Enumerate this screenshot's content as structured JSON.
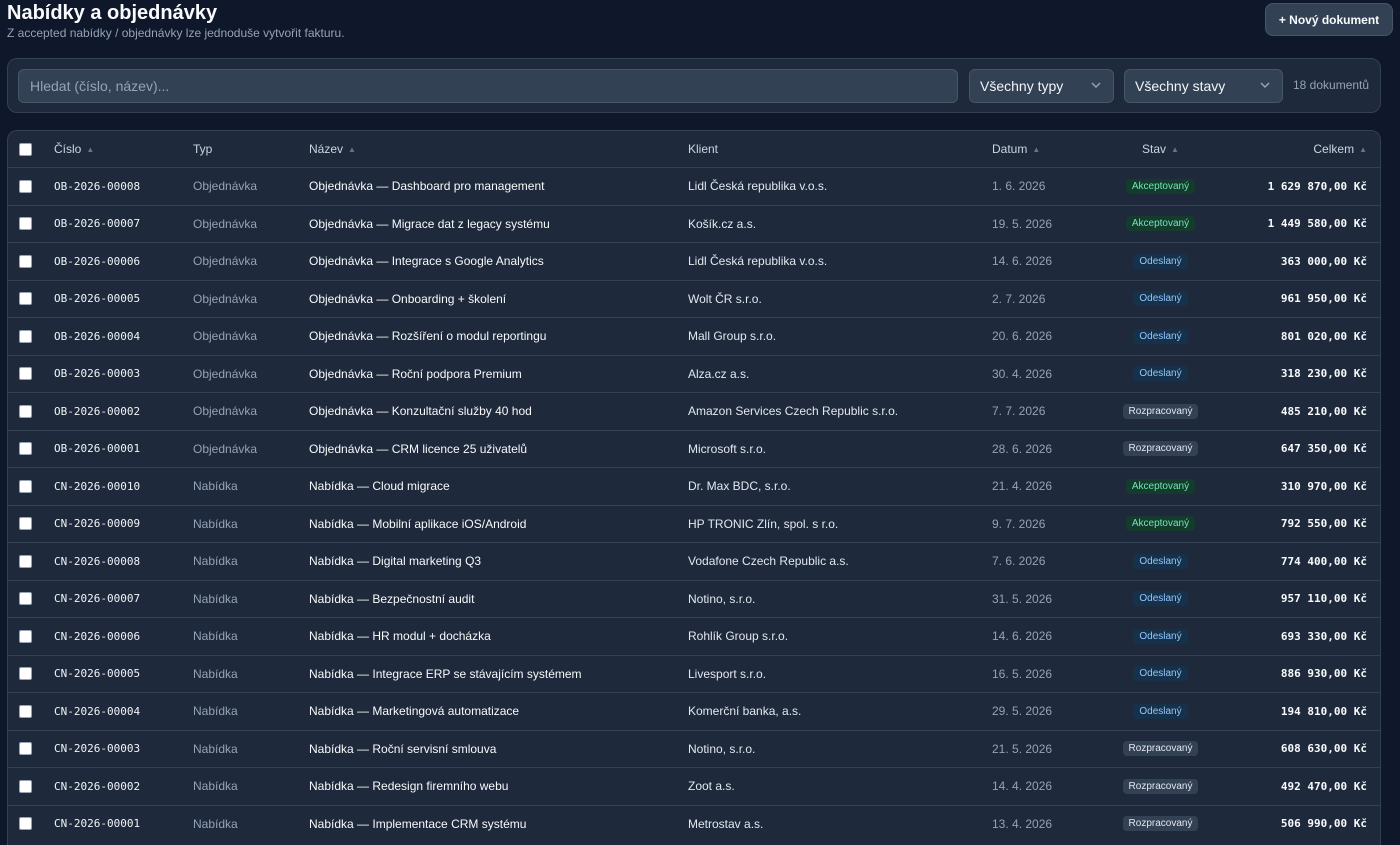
{
  "header": {
    "title": "Nabídky a objednávky",
    "subtitle": "Z accepted nabídky / objednávky lze jednoduše vytvořit fakturu.",
    "new_button": "+ Nový dokument"
  },
  "filters": {
    "search_placeholder": "Hledat (číslo, název)...",
    "type_select": "Všechny typy",
    "state_select": "Všechny stavy",
    "count": "18 dokumentů"
  },
  "table": {
    "columns": {
      "number": "Číslo",
      "type": "Typ",
      "name": "Název",
      "client": "Klient",
      "date": "Datum",
      "state": "Stav",
      "total": "Celkem"
    },
    "rows": [
      {
        "number": "OB-2026-00008",
        "type": "Objednávka",
        "name": "Objednávka — Dashboard pro management",
        "client": "Lidl Česká republika v.o.s.",
        "date": "1. 6. 2026",
        "state": "Akceptovaný",
        "state_kind": "accepted",
        "total": "1 629 870,00 Kč"
      },
      {
        "number": "OB-2026-00007",
        "type": "Objednávka",
        "name": "Objednávka — Migrace dat z legacy systému",
        "client": "Košík.cz a.s.",
        "date": "19. 5. 2026",
        "state": "Akceptovaný",
        "state_kind": "accepted",
        "total": "1 449 580,00 Kč"
      },
      {
        "number": "OB-2026-00006",
        "type": "Objednávka",
        "name": "Objednávka — Integrace s Google Analytics",
        "client": "Lidl Česká republika v.o.s.",
        "date": "14. 6. 2026",
        "state": "Odeslaný",
        "state_kind": "sent",
        "total": "363 000,00 Kč"
      },
      {
        "number": "OB-2026-00005",
        "type": "Objednávka",
        "name": "Objednávka — Onboarding + školení",
        "client": "Wolt ČR s.r.o.",
        "date": "2. 7. 2026",
        "state": "Odeslaný",
        "state_kind": "sent",
        "total": "961 950,00 Kč"
      },
      {
        "number": "OB-2026-00004",
        "type": "Objednávka",
        "name": "Objednávka — Rozšíření o modul reportingu",
        "client": "Mall Group s.r.o.",
        "date": "20. 6. 2026",
        "state": "Odeslaný",
        "state_kind": "sent",
        "total": "801 020,00 Kč"
      },
      {
        "number": "OB-2026-00003",
        "type": "Objednávka",
        "name": "Objednávka — Roční podpora Premium",
        "client": "Alza.cz a.s.",
        "date": "30. 4. 2026",
        "state": "Odeslaný",
        "state_kind": "sent",
        "total": "318 230,00 Kč"
      },
      {
        "number": "OB-2026-00002",
        "type": "Objednávka",
        "name": "Objednávka — Konzultační služby 40 hod",
        "client": "Amazon Services Czech Republic s.r.o.",
        "date": "7. 7. 2026",
        "state": "Rozpracovaný",
        "state_kind": "draft",
        "total": "485 210,00 Kč"
      },
      {
        "number": "OB-2026-00001",
        "type": "Objednávka",
        "name": "Objednávka — CRM licence 25 uživatelů",
        "client": "Microsoft s.r.o.",
        "date": "28. 6. 2026",
        "state": "Rozpracovaný",
        "state_kind": "draft",
        "total": "647 350,00 Kč"
      },
      {
        "number": "CN-2026-00010",
        "type": "Nabídka",
        "name": "Nabídka — Cloud migrace",
        "client": "Dr. Max BDC, s.r.o.",
        "date": "21. 4. 2026",
        "state": "Akceptovaný",
        "state_kind": "accepted",
        "total": "310 970,00 Kč"
      },
      {
        "number": "CN-2026-00009",
        "type": "Nabídka",
        "name": "Nabídka — Mobilní aplikace iOS/Android",
        "client": "HP TRONIC Zlín, spol. s r.o.",
        "date": "9. 7. 2026",
        "state": "Akceptovaný",
        "state_kind": "accepted",
        "total": "792 550,00 Kč"
      },
      {
        "number": "CN-2026-00008",
        "type": "Nabídka",
        "name": "Nabídka — Digital marketing Q3",
        "client": "Vodafone Czech Republic a.s.",
        "date": "7. 6. 2026",
        "state": "Odeslaný",
        "state_kind": "sent",
        "total": "774 400,00 Kč"
      },
      {
        "number": "CN-2026-00007",
        "type": "Nabídka",
        "name": "Nabídka — Bezpečnostní audit",
        "client": "Notino, s.r.o.",
        "date": "31. 5. 2026",
        "state": "Odeslaný",
        "state_kind": "sent",
        "total": "957 110,00 Kč"
      },
      {
        "number": "CN-2026-00006",
        "type": "Nabídka",
        "name": "Nabídka — HR modul + docházka",
        "client": "Rohlík Group s.r.o.",
        "date": "14. 6. 2026",
        "state": "Odeslaný",
        "state_kind": "sent",
        "total": "693 330,00 Kč"
      },
      {
        "number": "CN-2026-00005",
        "type": "Nabídka",
        "name": "Nabídka — Integrace ERP se stávajícím systémem",
        "client": "Livesport s.r.o.",
        "date": "16. 5. 2026",
        "state": "Odeslaný",
        "state_kind": "sent",
        "total": "886 930,00 Kč"
      },
      {
        "number": "CN-2026-00004",
        "type": "Nabídka",
        "name": "Nabídka — Marketingová automatizace",
        "client": "Komerční banka, a.s.",
        "date": "29. 5. 2026",
        "state": "Odeslaný",
        "state_kind": "sent",
        "total": "194 810,00 Kč"
      },
      {
        "number": "CN-2026-00003",
        "type": "Nabídka",
        "name": "Nabídka — Roční servisní smlouva",
        "client": "Notino, s.r.o.",
        "date": "21. 5. 2026",
        "state": "Rozpracovaný",
        "state_kind": "draft",
        "total": "608 630,00 Kč"
      },
      {
        "number": "CN-2026-00002",
        "type": "Nabídka",
        "name": "Nabídka — Redesign firemního webu",
        "client": "Zoot a.s.",
        "date": "14. 4. 2026",
        "state": "Rozpracovaný",
        "state_kind": "draft",
        "total": "492 470,00 Kč"
      },
      {
        "number": "CN-2026-00001",
        "type": "Nabídka",
        "name": "Nabídka — Implementace CRM systému",
        "client": "Metrostav a.s.",
        "date": "13. 4. 2026",
        "state": "Rozpracovaný",
        "state_kind": "draft",
        "total": "506 990,00 Kč"
      }
    ]
  },
  "colors": {
    "background": "#0f172a",
    "panel": "#1e293b",
    "accepted": "#6ee7b7",
    "sent": "#93c5fd",
    "draft": "#e2e8f0"
  }
}
